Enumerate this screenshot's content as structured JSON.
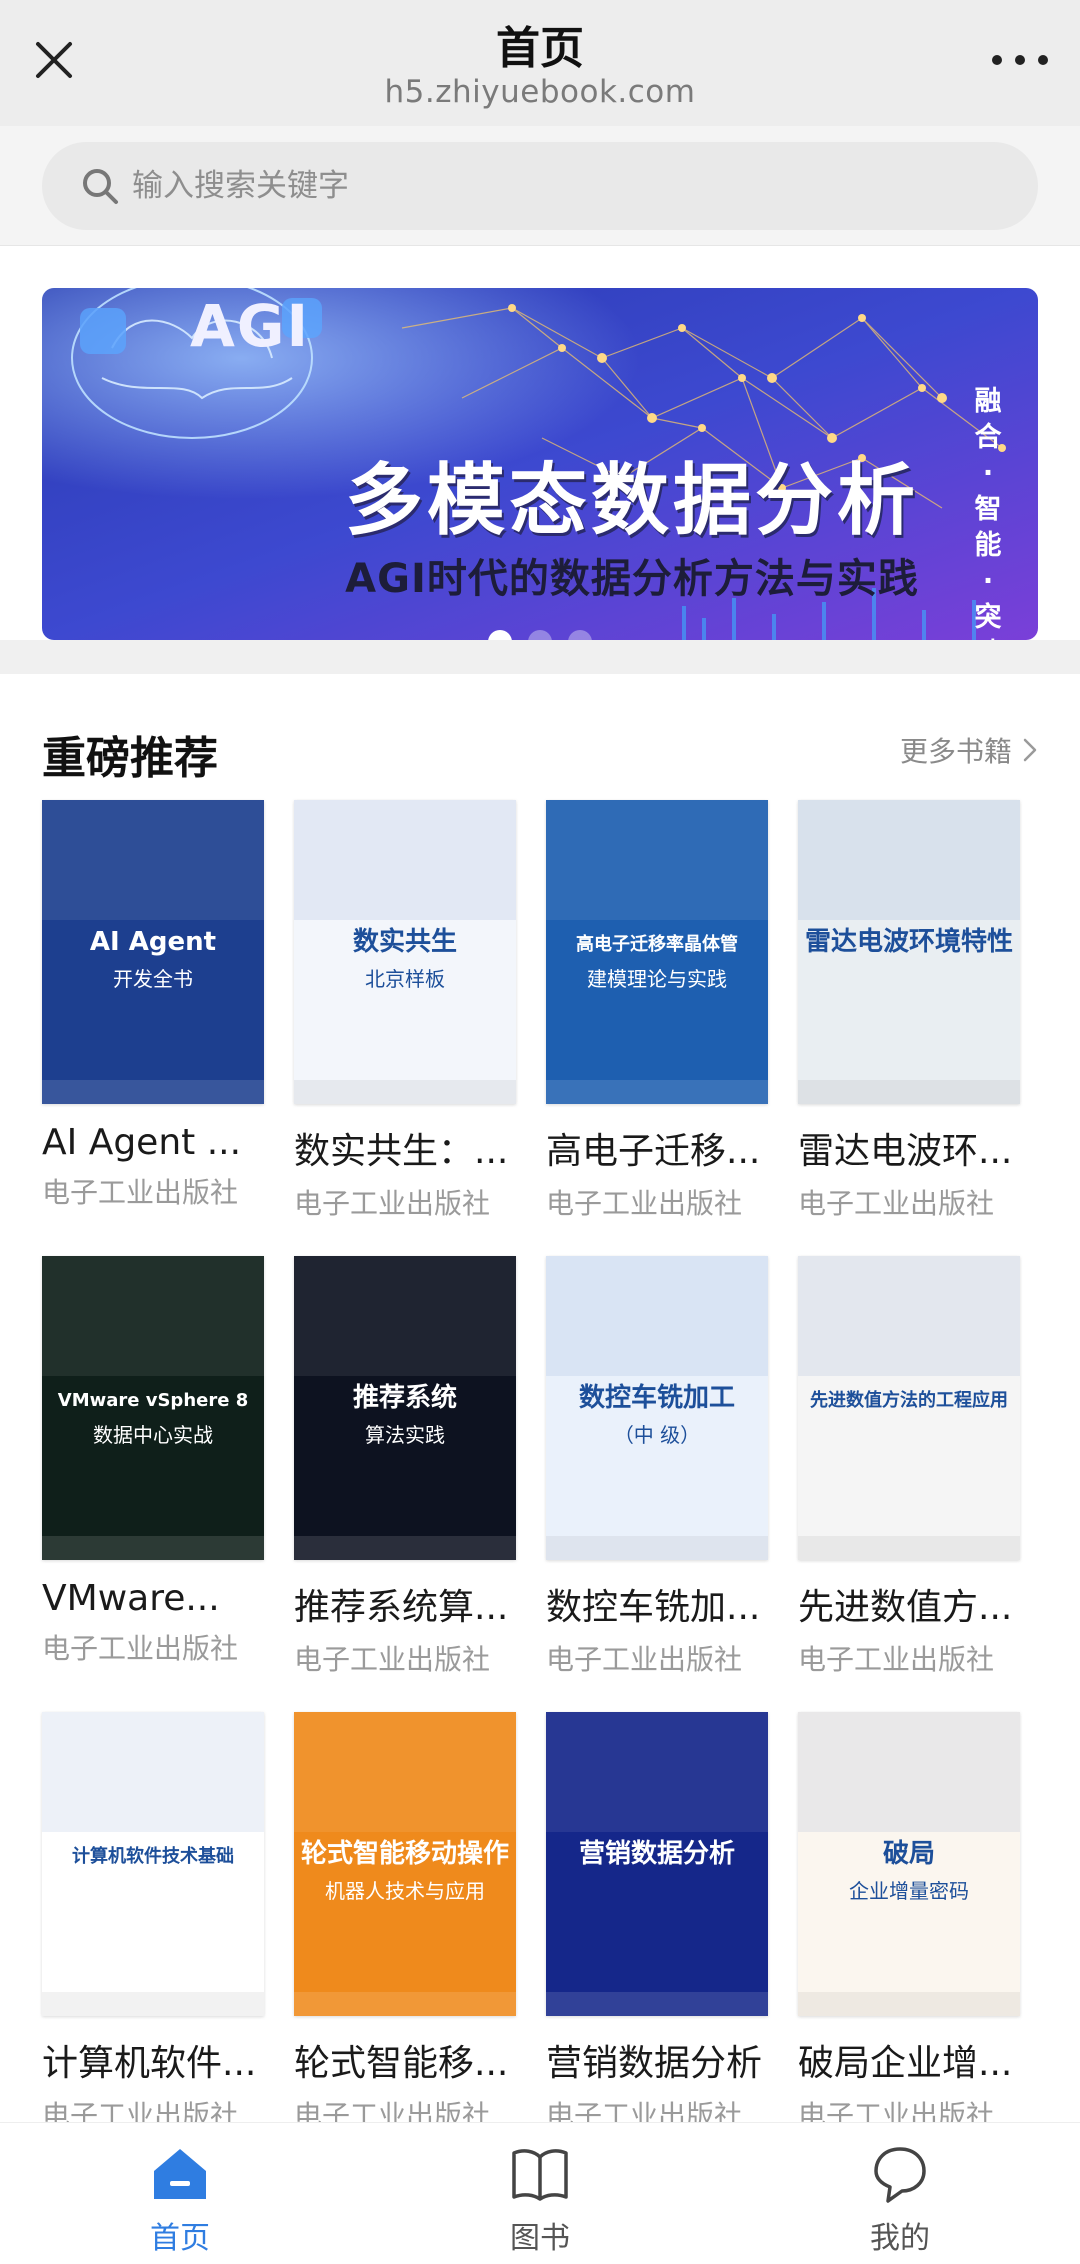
{
  "header": {
    "title": "首页",
    "url": "h5.zhiyuebook.com"
  },
  "search": {
    "placeholder": "输入搜索关键字"
  },
  "banner": {
    "tag": "AGI",
    "title": "多模态数据分析",
    "subtitle": "AGI时代的数据分析方法与实践",
    "side_text": "融合·智能·突破",
    "slide_count": 3,
    "active_slide": 0
  },
  "section": {
    "title": "重磅推荐",
    "more_label": "更多书籍"
  },
  "books": [
    {
      "title": "AI Agent 开发全书",
      "display": "AI Agent ...",
      "publisher": "电子工业出版社",
      "cover_text": "AI Agent",
      "cover_sub": "开发全书",
      "cover_color": "#1d3f8f"
    },
    {
      "title": "数实共生：北京样板",
      "display": "数实共生：...",
      "publisher": "电子工业出版社",
      "cover_text": "数实共生",
      "cover_sub": "北京样板",
      "cover_color": "#f3f6fb"
    },
    {
      "title": "高电子迁移率晶体管建模理论与实践",
      "display": "高电子迁移...",
      "publisher": "电子工业出版社",
      "cover_text": "高电子迁移率晶体管",
      "cover_sub": "建模理论与实践",
      "cover_color": "#1e5fb0"
    },
    {
      "title": "雷达电波环境特性",
      "display": "雷达电波环...",
      "publisher": "电子工业出版社",
      "cover_text": "雷达电波环境特性",
      "cover_sub": "",
      "cover_color": "#e9eef2"
    },
    {
      "title": "VMware vSphere 8 数据中心实战",
      "display": "VMware...",
      "publisher": "电子工业出版社",
      "cover_text": "VMware vSphere 8",
      "cover_sub": "数据中心实战",
      "cover_color": "#0f1f1a"
    },
    {
      "title": "推荐系统算法实践",
      "display": "推荐系统算...",
      "publisher": "电子工业出版社",
      "cover_text": "推荐系统",
      "cover_sub": "算法实践",
      "cover_color": "#0d1220"
    },
    {
      "title": "数控车铣加工（中级）",
      "display": "数控车铣加...",
      "publisher": "电子工业出版社",
      "cover_text": "数控车铣加工",
      "cover_sub": "（中 级）",
      "cover_color": "#eaf1fb"
    },
    {
      "title": "先进数值方法的工程应用",
      "display": "先进数值方...",
      "publisher": "电子工业出版社",
      "cover_text": "先进数值方法的工程应用",
      "cover_sub": "",
      "cover_color": "#f5f5f5"
    },
    {
      "title": "计算机软件技术基础",
      "display": "计算机软件...",
      "publisher": "电子工业出版社",
      "cover_text": "计算机软件技术基础",
      "cover_sub": "",
      "cover_color": "#ffffff"
    },
    {
      "title": "轮式智能移动操作机器人技术与应用",
      "display": "轮式智能移...",
      "publisher": "电子工业出版社",
      "cover_text": "轮式智能移动操作",
      "cover_sub": "机器人技术与应用",
      "cover_color": "#ef8a1c"
    },
    {
      "title": "营销数据分析",
      "display": "营销数据分析",
      "publisher": "电子工业出版社",
      "cover_text": "营销数据分析",
      "cover_sub": "",
      "cover_color": "#15278a"
    },
    {
      "title": "破局企业增量密码",
      "display": "破局企业增...",
      "publisher": "电子工业出版社",
      "cover_text": "破局",
      "cover_sub": "企业增量密码",
      "cover_color": "#fbf6ef"
    }
  ],
  "tabs": [
    {
      "label": "首页",
      "icon": "home-icon",
      "active": true
    },
    {
      "label": "图书",
      "icon": "book-icon",
      "active": false
    },
    {
      "label": "我的",
      "icon": "profile-icon",
      "active": false
    }
  ],
  "colors": {
    "accent": "#2f7de1",
    "header_bg": "#ededed",
    "banner_start": "#2a3fb8",
    "banner_end": "#6a3fd6"
  }
}
